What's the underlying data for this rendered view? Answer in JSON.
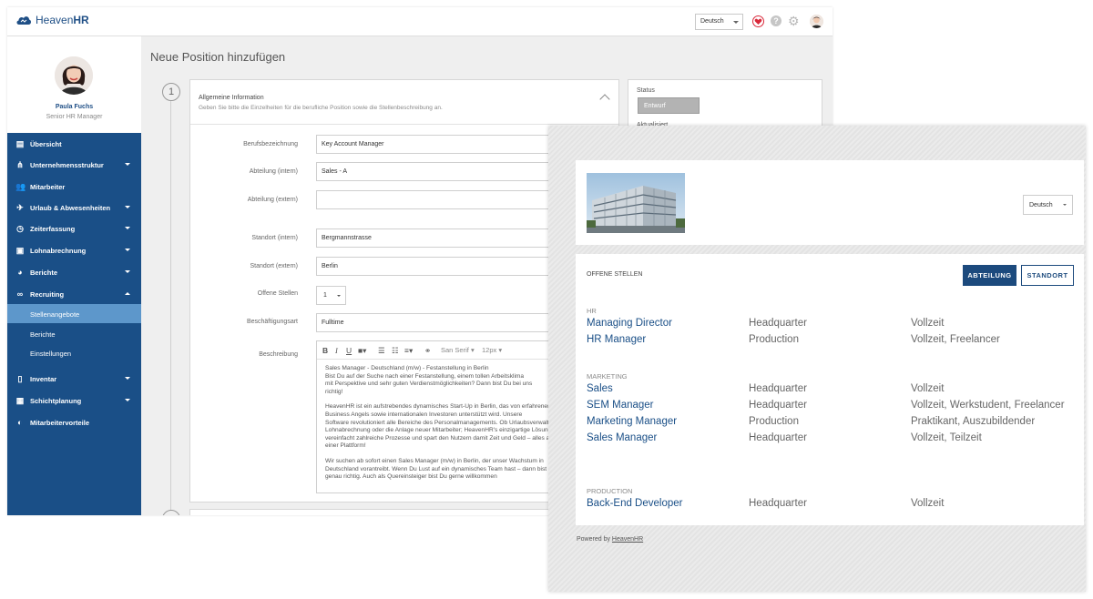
{
  "app": {
    "logo_text_light": "Heaven",
    "logo_text_bold": "HR",
    "language": "Deutsch",
    "icons": [
      "heart-icon",
      "help-icon",
      "gear-icon",
      "user-avatar"
    ]
  },
  "profile": {
    "name": "Paula Fuchs",
    "role": "Senior HR Manager"
  },
  "nav": {
    "items": [
      {
        "label": "Übersicht",
        "icon": "dashboard-icon",
        "caret": ""
      },
      {
        "label": "Unternehmensstruktur",
        "icon": "org-chart-icon",
        "caret": "down"
      },
      {
        "label": "Mitarbeiter",
        "icon": "people-icon",
        "caret": ""
      },
      {
        "label": "Urlaub & Abwesenheiten",
        "icon": "plane-icon",
        "caret": "down"
      },
      {
        "label": "Zeiterfassung",
        "icon": "clock-icon",
        "caret": "down"
      },
      {
        "label": "Lohnabrechnung",
        "icon": "wallet-icon",
        "caret": "down"
      },
      {
        "label": "Berichte",
        "icon": "pie-chart-icon",
        "caret": "down"
      },
      {
        "label": "Recruiting",
        "icon": "binoculars-icon",
        "caret": "up"
      }
    ],
    "subitems": [
      {
        "label": "Stellenangebote",
        "active": true
      },
      {
        "label": "Berichte",
        "active": false
      },
      {
        "label": "Einstellungen",
        "active": false
      }
    ],
    "items_after": [
      {
        "label": "Inventar",
        "icon": "phone-icon",
        "caret": "down"
      },
      {
        "label": "Schichtplanung",
        "icon": "calendar-icon",
        "caret": "down"
      },
      {
        "label": "Mitarbeitervorteile",
        "icon": "shield-icon",
        "caret": ""
      }
    ]
  },
  "form": {
    "page_title": "Neue Position hinzufügen",
    "step_number": "1",
    "section_title": "Allgemeine Information",
    "section_desc": "Geben Sie bitte die Einzelheiten für die berufliche Position sowie die Stellenbeschreibung an.",
    "fields": {
      "berufsbezeichnung": {
        "label": "Berufsbezeichnung",
        "value": "Key Account Manager"
      },
      "abteilung_intern": {
        "label": "Abteilung (intern)",
        "value": "Sales - A"
      },
      "abteilung_extern": {
        "label": "Abteilung (extern)",
        "value": ""
      },
      "standort_intern": {
        "label": "Standort (intern)",
        "value": "Bergmannstrasse"
      },
      "standort_extern": {
        "label": "Standort (extern)",
        "value": "Berlin"
      },
      "offene_stellen": {
        "label": "Offene Stellen",
        "value": "1"
      },
      "beschaeftigungsart": {
        "label": "Beschäftigungsart",
        "value": "Fulltime"
      },
      "beschreibung": {
        "label": "Beschreibung"
      }
    },
    "editor": {
      "font": "San Serif",
      "size": "12px",
      "paragraphs": [
        "Sales Manager - Deutschland (m/w) - Festanstellung in Berlin\nBist Du auf der Suche nach einer Festanstellung, einem tollen Arbeitsklima\nmit Perspektive und sehr guten Verdienstmöglichkeiten? Dann bist Du bei uns\nrichtig!",
        "HeavenHR ist ein aufstrebendes dynamisches Start-Up in Berlin, das von erfahrenen\nBusiness Angels sowie internationalen Investoren unterstützt wird. Unsere\nSoftware revolutioniert alle Bereiche des Personalmanagements. Ob Urlaubsverwaltung,\nLohnabrechnung oder die Anlage neuer Mitarbeiter; HeavenHR's einzigartige Lösung\nvereinfacht zahlreiche Prozesse und spart den Nutzern damit Zeit und Geld – alles auf\neiner Plattform!",
        "Wir suchen ab sofort einen Sales Manager (m/w) in Berlin, der unser Wachstum in\nDeutschland vorantreibt. Wenn Du Lust auf ein dynamisches Team hast – dann bist Du\ngenau richtig. Auch als Quereinsteiger bist Du gerne willkommen"
      ]
    }
  },
  "status": {
    "label": "Status",
    "value": "Entwurf",
    "updated_label": "Aktualisiert"
  },
  "career_page": {
    "language": "Deutsch",
    "offers_label": "OFFENE STELLEN",
    "filter_buttons": [
      "ABTEILUNG",
      "STANDORT"
    ],
    "groups": [
      {
        "name": "HR",
        "jobs": [
          {
            "title": "Managing Director",
            "location": "Headquarter",
            "type": "Vollzeit"
          },
          {
            "title": "HR Manager",
            "location": "Production",
            "type": "Vollzeit, Freelancer"
          }
        ]
      },
      {
        "name": "MARKETING",
        "jobs": [
          {
            "title": "Sales",
            "location": "Headquarter",
            "type": "Vollzeit"
          },
          {
            "title": "SEM Manager",
            "location": "Headquarter",
            "type": "Vollzeit, Werkstudent, Freelancer"
          },
          {
            "title": "Marketing Manager",
            "location": "Production",
            "type": "Praktikant, Auszubildender"
          },
          {
            "title": "Sales Manager",
            "location": "Headquarter",
            "type": "Vollzeit, Teilzeit"
          }
        ]
      },
      {
        "name": "PRODUCTION",
        "jobs": [
          {
            "title": "Back-End Developer",
            "location": "Headquarter",
            "type": "Vollzeit"
          }
        ]
      }
    ],
    "powered_prefix": "Powered by",
    "powered_link": "HeavenHR"
  }
}
